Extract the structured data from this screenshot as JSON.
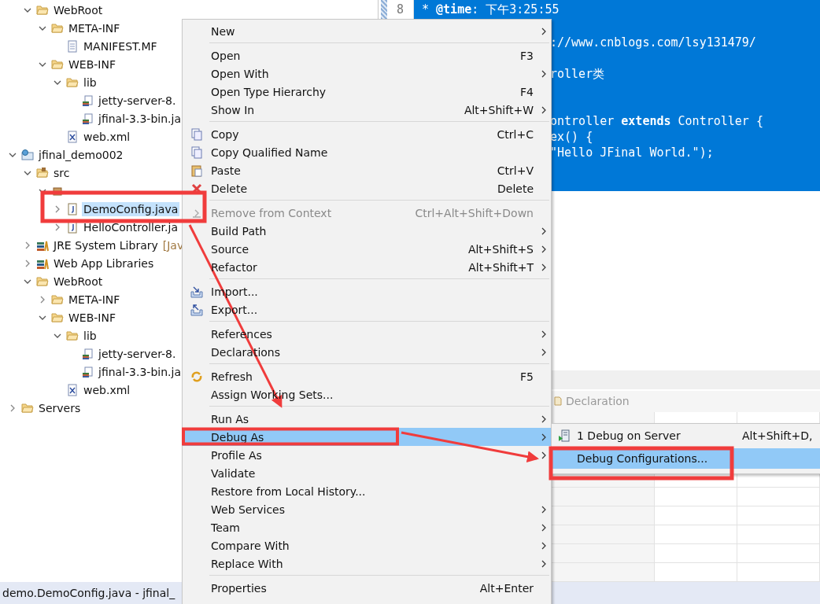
{
  "tree_continued": [
    {
      "label": "WebRoot",
      "kind": "folder",
      "expanded": true,
      "selected": false,
      "children": [
        {
          "label": "META-INF",
          "kind": "folder",
          "expanded": true,
          "selected": false,
          "children": [
            {
              "label": "MANIFEST.MF",
              "kind": "file",
              "selected": false
            }
          ]
        },
        {
          "label": "WEB-INF",
          "kind": "folder",
          "expanded": true,
          "selected": false,
          "children": [
            {
              "label": "lib",
              "kind": "folder",
              "expanded": true,
              "selected": false,
              "children": [
                {
                  "label": "jetty-server-8.",
                  "kind": "jar",
                  "selected": false
                },
                {
                  "label": "jfinal-3.3-bin.ja",
                  "kind": "jar",
                  "selected": false
                }
              ]
            },
            {
              "label": "web.xml",
              "kind": "xml",
              "selected": false
            }
          ]
        }
      ]
    }
  ],
  "tree": [
    {
      "label": "jfinal_demo002",
      "kind": "project",
      "expanded": true,
      "selected": false,
      "children": [
        {
          "label": "src",
          "kind": "source",
          "expanded": true,
          "selected": false,
          "children": [
            {
              "kind": "package",
              "expanded": true,
              "selected": false,
              "children": [
                {
                  "label": "DemoConfig.java",
                  "kind": "java",
                  "expanded": false,
                  "selected": true
                },
                {
                  "label": "HelloController.ja",
                  "kind": "java",
                  "expanded": false,
                  "selected": false
                }
              ]
            }
          ]
        },
        {
          "label": "JRE System Library",
          "decoration": "[Jav",
          "kind": "library",
          "expanded": false,
          "selected": false
        },
        {
          "label": "Web App Libraries",
          "kind": "library",
          "expanded": false,
          "selected": false
        },
        {
          "label": "WebRoot",
          "kind": "folder",
          "expanded": true,
          "selected": false,
          "children": [
            {
              "label": "META-INF",
              "kind": "folder",
              "expanded": false,
              "selected": false
            },
            {
              "label": "WEB-INF",
              "kind": "folder",
              "expanded": true,
              "selected": false,
              "children": [
                {
                  "label": "lib",
                  "kind": "folder",
                  "expanded": true,
                  "selected": false,
                  "children": [
                    {
                      "label": "jetty-server-8.",
                      "kind": "jar",
                      "selected": false
                    },
                    {
                      "label": "jfinal-3.3-bin.ja",
                      "kind": "jar",
                      "selected": false
                    }
                  ]
                },
                {
                  "label": "web.xml",
                  "kind": "xml",
                  "selected": false
                }
              ]
            }
          ]
        }
      ]
    },
    {
      "label": "Servers",
      "kind": "folder",
      "expanded": false,
      "selected": false
    }
  ],
  "editor": {
    "line_number": "8",
    "first_line": "* **@time**: 下午3:25:55",
    "lines": [
      "://www.cnblogs.com/lsy131479/",
      "roller类",
      "ontroller **extends** Controller {",
      "ex() {",
      "\"Hello JFinal World.\");"
    ]
  },
  "declaration_tab": {
    "label": "Declaration"
  },
  "status_bar": "demo.DemoConfig.java - jfinal_",
  "context_menu": [
    {
      "kind": "item",
      "label": "New",
      "submenu": true,
      "disabled": false,
      "selected": false
    },
    {
      "kind": "separator"
    },
    {
      "kind": "item",
      "label": "Open",
      "shortcut": "F3",
      "submenu": false,
      "disabled": false,
      "selected": false
    },
    {
      "kind": "item",
      "label": "Open With",
      "submenu": true,
      "disabled": false,
      "selected": false
    },
    {
      "kind": "item",
      "label": "Open Type Hierarchy",
      "shortcut": "F4",
      "submenu": false,
      "disabled": false,
      "selected": false
    },
    {
      "kind": "item",
      "label": "Show In",
      "shortcut": "Alt+Shift+W",
      "submenu": true,
      "disabled": false,
      "selected": false
    },
    {
      "kind": "separator"
    },
    {
      "kind": "copy",
      "label": "Copy",
      "shortcut": "Ctrl+C",
      "submenu": false,
      "disabled": false,
      "selected": false
    },
    {
      "kind": "copy",
      "label": "Copy Qualified Name",
      "submenu": false,
      "disabled": false,
      "selected": false
    },
    {
      "kind": "paste",
      "label": "Paste",
      "shortcut": "Ctrl+V",
      "submenu": false,
      "disabled": false,
      "selected": false
    },
    {
      "kind": "delete",
      "label": "Delete",
      "shortcut": "Delete",
      "submenu": false,
      "disabled": false,
      "selected": false
    },
    {
      "kind": "separator"
    },
    {
      "kind": "remove",
      "label": "Remove from Context",
      "shortcut": "Ctrl+Alt+Shift+Down",
      "submenu": false,
      "disabled": true,
      "selected": false
    },
    {
      "kind": "item",
      "label": "Build Path",
      "submenu": true,
      "disabled": false,
      "selected": false
    },
    {
      "kind": "item",
      "label": "Source",
      "shortcut": "Alt+Shift+S",
      "submenu": true,
      "disabled": false,
      "selected": false
    },
    {
      "kind": "item",
      "label": "Refactor",
      "shortcut": "Alt+Shift+T",
      "submenu": true,
      "disabled": false,
      "selected": false
    },
    {
      "kind": "separator"
    },
    {
      "kind": "import",
      "label": "Import...",
      "submenu": false,
      "disabled": false,
      "selected": false
    },
    {
      "kind": "export",
      "label": "Export...",
      "submenu": false,
      "disabled": false,
      "selected": false
    },
    {
      "kind": "separator"
    },
    {
      "kind": "item",
      "label": "References",
      "submenu": true,
      "disabled": false,
      "selected": false
    },
    {
      "kind": "item",
      "label": "Declarations",
      "submenu": true,
      "disabled": false,
      "selected": false
    },
    {
      "kind": "separator"
    },
    {
      "kind": "refresh",
      "label": "Refresh",
      "shortcut": "F5",
      "submenu": false,
      "disabled": false,
      "selected": false
    },
    {
      "kind": "item",
      "label": "Assign Working Sets...",
      "submenu": false,
      "disabled": false,
      "selected": false
    },
    {
      "kind": "separator"
    },
    {
      "kind": "item",
      "label": "Run As",
      "submenu": true,
      "disabled": false,
      "selected": false
    },
    {
      "kind": "item",
      "label": "Debug As",
      "submenu": true,
      "disabled": false,
      "selected": true
    },
    {
      "kind": "item",
      "label": "Profile As",
      "submenu": true,
      "disabled": false,
      "selected": false
    },
    {
      "kind": "item",
      "label": "Validate",
      "submenu": false,
      "disabled": false,
      "selected": false
    },
    {
      "kind": "item",
      "label": "Restore from Local History...",
      "submenu": false,
      "disabled": false,
      "selected": false
    },
    {
      "kind": "item",
      "label": "Web Services",
      "submenu": true,
      "disabled": false,
      "selected": false
    },
    {
      "kind": "item",
      "label": "Team",
      "submenu": true,
      "disabled": false,
      "selected": false
    },
    {
      "kind": "item",
      "label": "Compare With",
      "submenu": true,
      "disabled": false,
      "selected": false
    },
    {
      "kind": "item",
      "label": "Replace With",
      "submenu": true,
      "disabled": false,
      "selected": false
    },
    {
      "kind": "separator"
    },
    {
      "kind": "item",
      "label": "Properties",
      "shortcut": "Alt+Enter",
      "submenu": false,
      "disabled": false,
      "selected": false
    }
  ],
  "submenu": [
    {
      "kind": "server",
      "label": "1 Debug on Server",
      "shortcut": "Alt+Shift+D,",
      "selected": false
    },
    {
      "kind": "plain",
      "label": "Debug Configurations...",
      "selected": true
    }
  ]
}
